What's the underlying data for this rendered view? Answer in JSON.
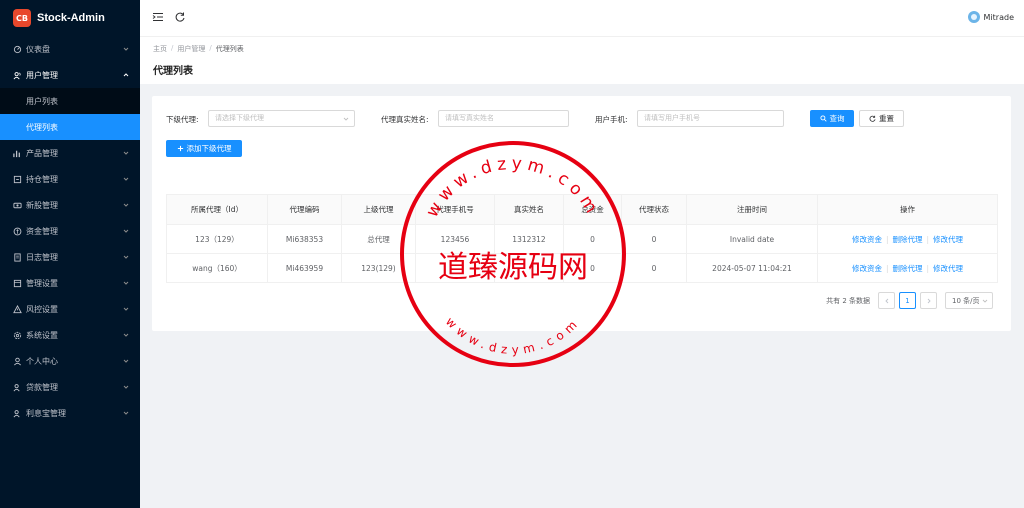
{
  "brand": {
    "title": "Stock-Admin",
    "logo_text": "CB"
  },
  "sidebar": {
    "items": [
      {
        "label": "仪表盘",
        "icon": "dashboard-icon"
      },
      {
        "label": "用户管理",
        "icon": "users-icon",
        "open": true
      },
      {
        "label": "产品管理",
        "icon": "product-icon"
      },
      {
        "label": "持仓管理",
        "icon": "position-icon"
      },
      {
        "label": "新股管理",
        "icon": "ipo-icon"
      },
      {
        "label": "资金管理",
        "icon": "money-icon"
      },
      {
        "label": "日志管理",
        "icon": "log-icon"
      },
      {
        "label": "管理设置",
        "icon": "admin-settings-icon"
      },
      {
        "label": "风控设置",
        "icon": "risk-icon"
      },
      {
        "label": "系统设置",
        "icon": "settings-icon"
      },
      {
        "label": "个人中心",
        "icon": "person-icon"
      },
      {
        "label": "贷款管理",
        "icon": "loan-icon"
      },
      {
        "label": "利息宝管理",
        "icon": "interest-icon"
      }
    ],
    "sub_items": [
      {
        "label": "用户列表",
        "active": false
      },
      {
        "label": "代理列表",
        "active": true
      }
    ]
  },
  "header": {
    "user_name": "Mitrade"
  },
  "breadcrumb": {
    "home": "主页",
    "section": "用户管理",
    "current": "代理列表"
  },
  "page_title": "代理列表",
  "filters": {
    "parent_label": "下级代理:",
    "parent_placeholder": "请选择下级代理",
    "name_label": "代理真实姓名:",
    "name_placeholder": "请填写真实姓名",
    "phone_label": "用户手机:",
    "phone_placeholder": "请填写用户手机号",
    "search_label": "查询",
    "reset_label": "重置",
    "add_label": "添加下级代理"
  },
  "table": {
    "columns": [
      "所属代理（Id）",
      "代理编码",
      "上级代理",
      "代理手机号",
      "真实姓名",
      "总资金",
      "代理状态",
      "注册时间",
      "操作"
    ],
    "rows": [
      [
        "123（129）",
        "Mi638353",
        "总代理",
        "123456",
        "1312312",
        "0",
        "0",
        "Invalid date"
      ],
      [
        "wang（160）",
        "Mi463959",
        "123(129)",
        "",
        "",
        "0",
        "0",
        "2024-05-07 11:04:21"
      ]
    ],
    "actions": [
      "修改资金",
      "删除代理",
      "修改代理"
    ]
  },
  "pagination": {
    "total_text": "共有 2 条数据",
    "current_page": "1",
    "page_size": "10 条/页"
  },
  "watermark": {
    "center_text": "道臻源码网",
    "ring_text_top": "www.dzym.com",
    "ring_text_bottom": "www.dzym.com",
    "color": "#e60012"
  },
  "colors": {
    "sidebar_bg": "#001529",
    "accent": "#1890ff",
    "brand": "#e8482c"
  }
}
